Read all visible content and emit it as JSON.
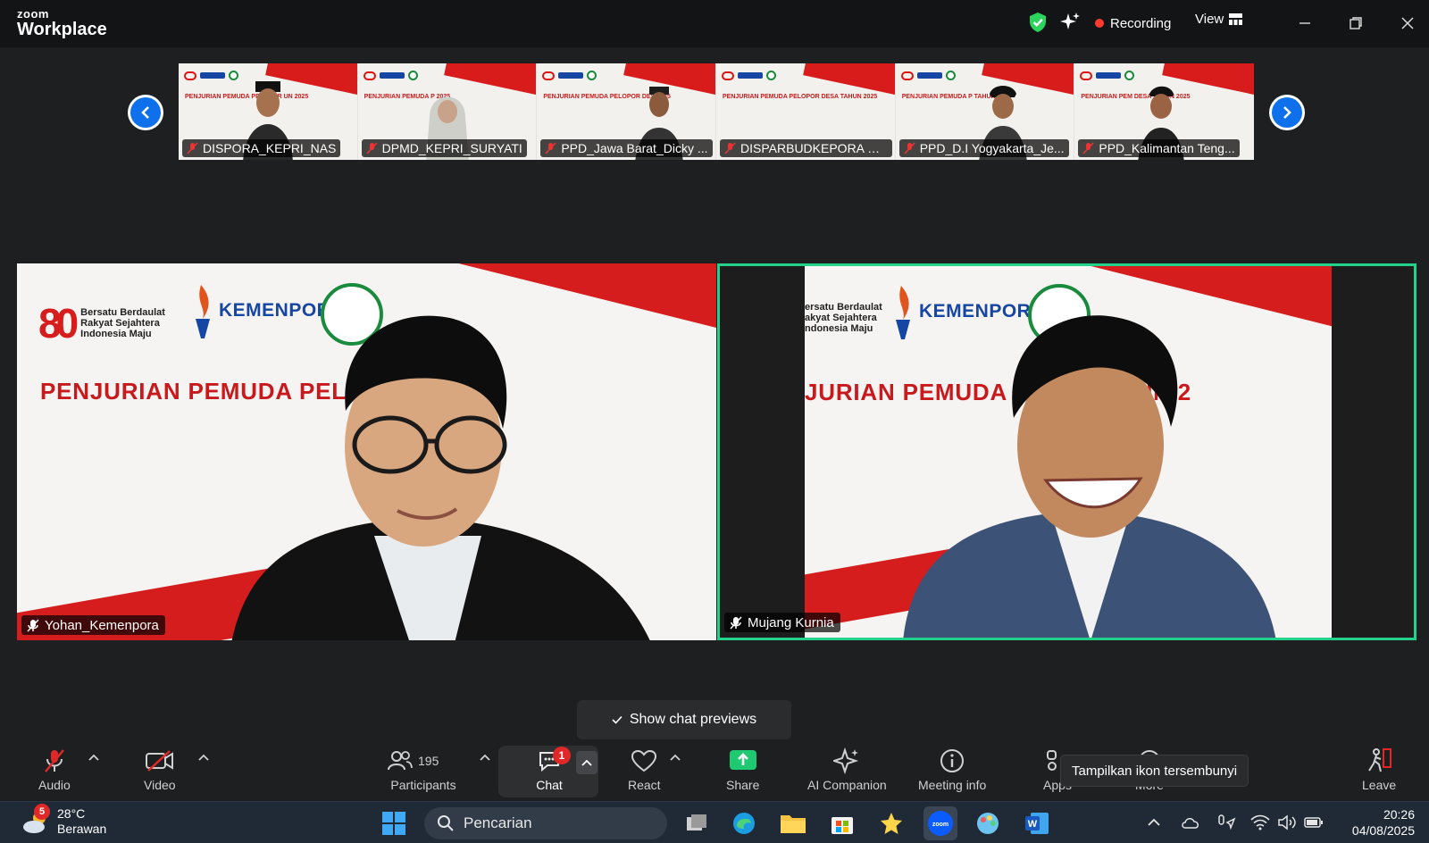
{
  "window": {
    "brand_top": "zoom",
    "brand_bottom": "Workplace",
    "recording_label": "Recording",
    "view_label": "View"
  },
  "thumbnails": [
    {
      "name": "DISPORA_KEPRI_NAS",
      "slide_text": "PENJURIAN PEMUDA PELOPOR     UN 2025"
    },
    {
      "name": "DPMD_KEPRI_SURYATI",
      "slide_text": "PENJURIAN PEMUDA P          2025"
    },
    {
      "name": "PPD_Jawa Barat_Dicky ...",
      "slide_text": "PENJURIAN PEMUDA PELOPOR DES   2025"
    },
    {
      "name": "DISPARBUDKEPORA Pr...",
      "slide_text": "PENJURIAN PEMUDA PELOPOR DESA TAHUN 2025"
    },
    {
      "name": "PPD_D.I Yogyakarta_Je...",
      "slide_text": "PENJURIAN PEMUDA P      TAHUN 2025"
    },
    {
      "name": "PPD_Kalimantan Teng...",
      "slide_text": "PENJURIAN PEM        DESA TAHUN 2025"
    }
  ],
  "main_tiles": [
    {
      "name": "Yohan_Kemenpora",
      "slide_number": "80",
      "tagline": [
        "Bersatu Berdaulat",
        "Rakyat Sejahtera",
        "Indonesia Maju"
      ],
      "org": "KEMENPORA",
      "headline": "PENJURIAN PEMUDA PELC                    N 2025"
    },
    {
      "name": "Mujang Kurnia",
      "tagline": [
        "ersatu Berdaulat",
        "akyat Sejahtera",
        "ndonesia Maju"
      ],
      "org": "KEMENPORA",
      "headline": "JURIAN PEMUDA               DESA TAHUN 2"
    }
  ],
  "chat_preview": {
    "label": "Show chat previews"
  },
  "toolbar": {
    "audio": "Audio",
    "video": "Video",
    "participants": "Participants",
    "participants_count": "195",
    "chat": "Chat",
    "chat_badge": "1",
    "react": "React",
    "share": "Share",
    "ai_companion": "AI Companion",
    "meeting_info": "Meeting info",
    "apps": "Apps",
    "more": "More",
    "leave": "Leave"
  },
  "tooltip": "Tampilkan ikon tersembunyi",
  "taskbar": {
    "temperature": "28°C",
    "weather": "Berawan",
    "weather_badge": "5",
    "search_placeholder": "Pencarian",
    "time": "20:26",
    "date": "04/08/2025"
  },
  "colors": {
    "accent": "#0e71eb",
    "active_speaker": "#23d18b",
    "recording": "#ff3b30",
    "share": "#1ec971",
    "leave": "#e02828"
  }
}
